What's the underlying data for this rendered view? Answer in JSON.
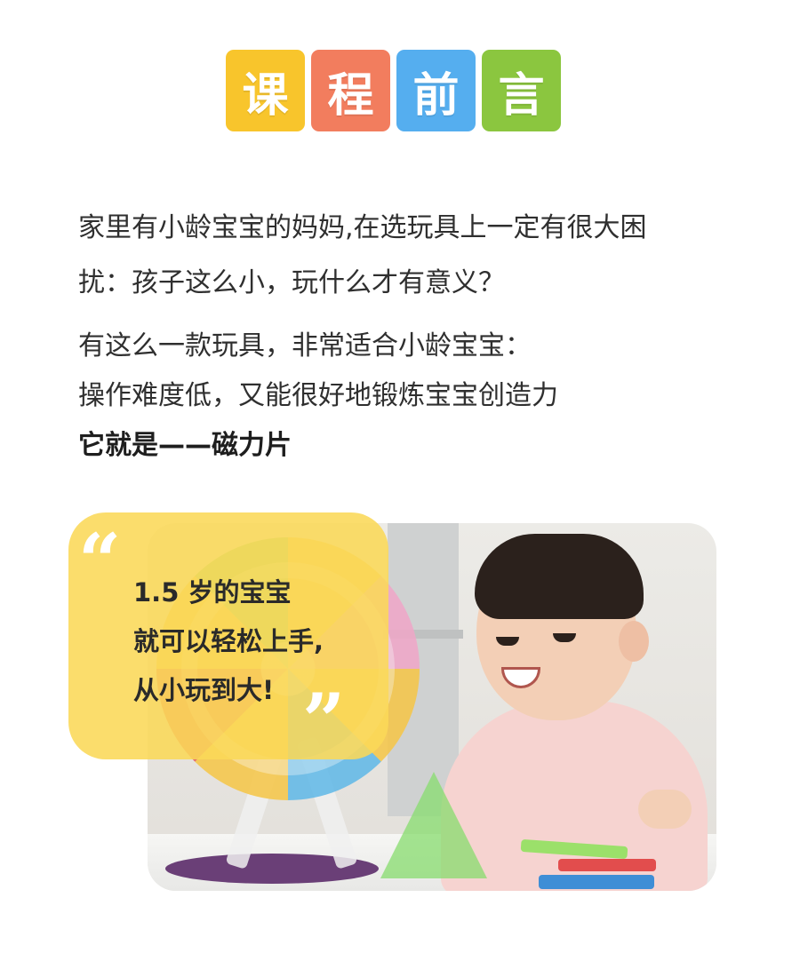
{
  "header": {
    "tiles": [
      {
        "char": "课",
        "color": "#F8C52C"
      },
      {
        "char": "程",
        "color": "#F27D5E"
      },
      {
        "char": "前",
        "color": "#55AEEF"
      },
      {
        "char": "言",
        "color": "#8BC63F"
      }
    ]
  },
  "intro": {
    "para1_line1": "家里有小龄宝宝的妈妈,在选玩具上一定有很大困",
    "para1_line2": "扰：孩子这么小，玩什么才有意义？",
    "para2_line1": "有这么一款玩具，非常适合小龄宝宝：",
    "para2_line2": "操作难度低，又能很好地锻炼宝宝创造力",
    "para2_line3": "它就是——磁力片"
  },
  "quote": {
    "open_mark": "“",
    "close_mark": "”",
    "line1": "1.5 岁的宝宝",
    "line2": "就可以轻松上手,",
    "line3": "从小玩到大!",
    "bubble_color": "#FAD858"
  }
}
